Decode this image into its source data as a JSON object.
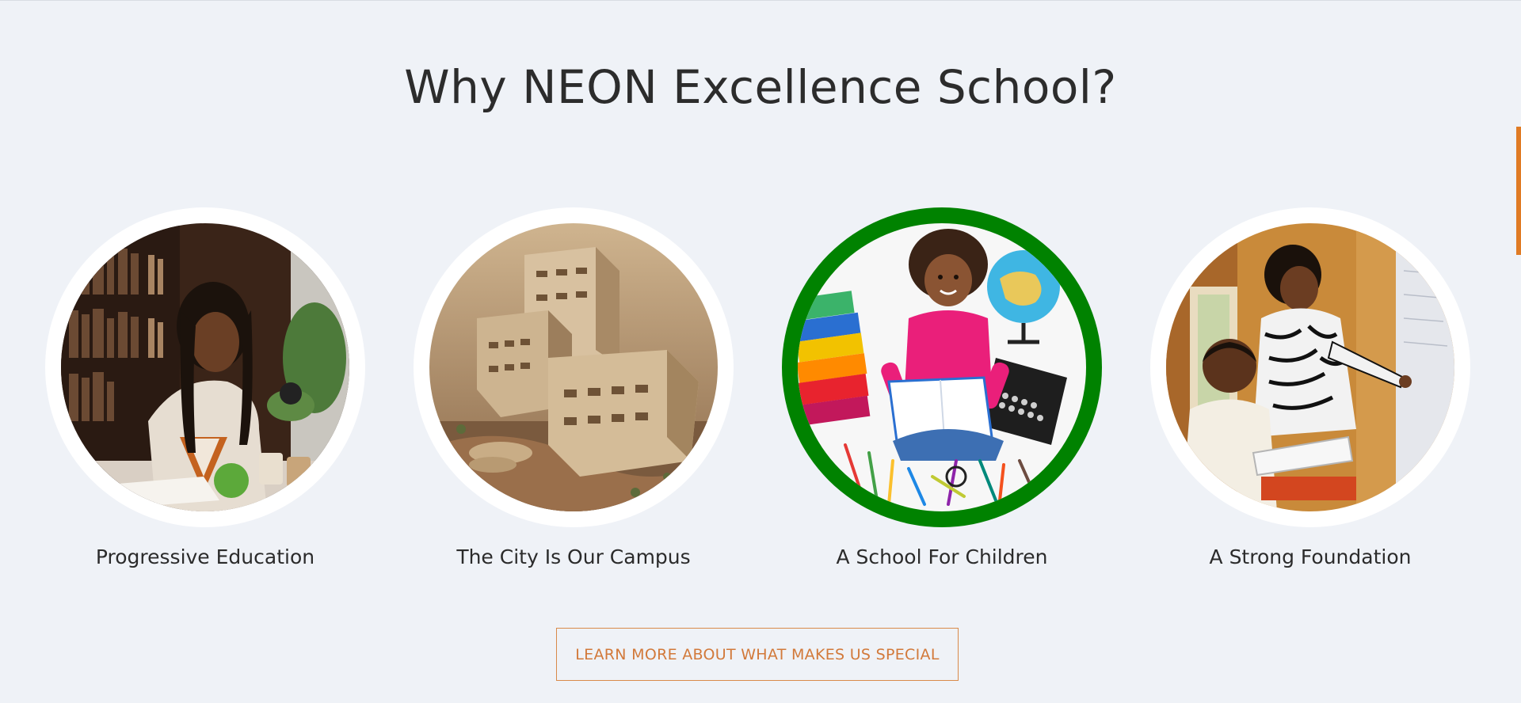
{
  "section": {
    "title": "Why NEON Excellence School?"
  },
  "features": [
    {
      "label": "Progressive Education",
      "image": "student-studying-library-photo",
      "highlighted": false
    },
    {
      "label": "The City Is Our Campus",
      "image": "campus-building-aerial-photo",
      "highlighted": false
    },
    {
      "label": "A School For Children",
      "image": "child-drawing-with-supplies-photo",
      "highlighted": true
    },
    {
      "label": "A Strong Foundation",
      "image": "teacher-and-boy-at-whiteboard-photo",
      "highlighted": false
    }
  ],
  "cta": {
    "label": "LEARN MORE ABOUT WHAT MAKES US SPECIAL"
  },
  "colors": {
    "background": "#eff2f7",
    "ring": "#ffffff",
    "active_ring": "#008200",
    "accent": "#d2793a",
    "text": "#2c2c2c"
  }
}
